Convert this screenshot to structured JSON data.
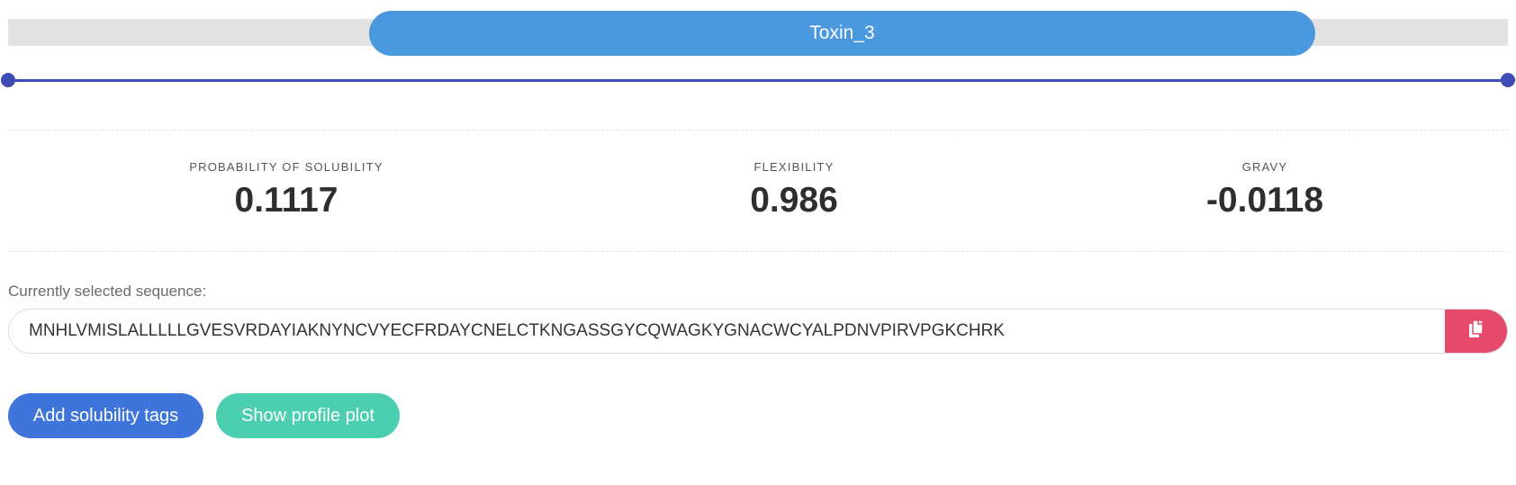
{
  "header": {
    "protein_name": "Toxin_3",
    "progress_fraction": 0.63
  },
  "stats": [
    {
      "label": "PROBABILITY OF SOLUBILITY",
      "value": "0.1117"
    },
    {
      "label": "FLEXIBILITY",
      "value": "0.986"
    },
    {
      "label": "GRAVY",
      "value": "-0.0118"
    }
  ],
  "sequence": {
    "label": "Currently selected sequence:",
    "value": "MNHLVMISLALLLLLGVESVRDAYIAKNYNCVYECFRDAYCNELCTKNGASSGYCQWAGKYGNACWCYALPDNVPIRVPGKCHRK",
    "copy_icon": "copy-icon"
  },
  "actions": {
    "add_tags_label": "Add solubility tags",
    "profile_plot_label": "Show profile plot"
  },
  "colors": {
    "progress_fill": "#4a98dd",
    "slider": "#3f4cb5",
    "copy_button": "#e5496b",
    "add_tags_button": "#3f75db",
    "profile_plot_button": "#4ccfb0"
  }
}
